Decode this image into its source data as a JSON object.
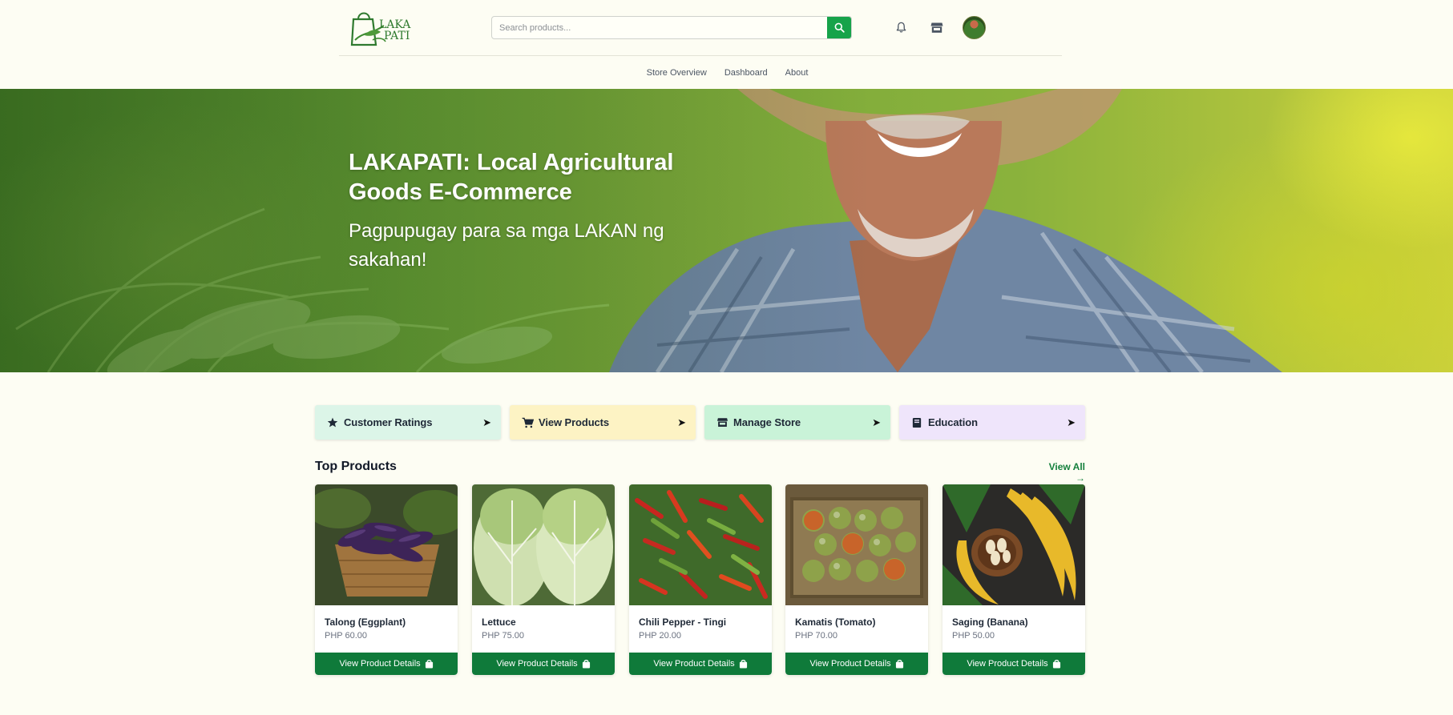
{
  "header": {
    "logo_text": "LAKAPATI",
    "search": {
      "placeholder": "Search products..."
    },
    "icons": [
      "search-icon",
      "bell-icon",
      "store-icon",
      "avatar"
    ]
  },
  "nav": {
    "items": [
      {
        "label": "Store Overview"
      },
      {
        "label": "Dashboard"
      },
      {
        "label": "About"
      }
    ]
  },
  "hero": {
    "title": "LAKAPATI: Local Agricultural Goods E-Commerce",
    "subtitle": "Pagpupugay para sa mga LAKAN ng sakahan!"
  },
  "quick_links": [
    {
      "label": "Customer Ratings",
      "icon": "star-icon",
      "bg": "#dcf5e8"
    },
    {
      "label": "View Products",
      "icon": "cart-icon",
      "bg": "#fdf3c4"
    },
    {
      "label": "Manage Store",
      "icon": "store-icon",
      "bg": "#c9f3d8"
    },
    {
      "label": "Education",
      "icon": "book-icon",
      "bg": "#efe5fb"
    }
  ],
  "top_products": {
    "title": "Top Products",
    "view_all": "View All →",
    "button_label": "View Product Details",
    "items": [
      {
        "name": "Talong (Eggplant)",
        "price": "PHP 60.00"
      },
      {
        "name": "Lettuce",
        "price": "PHP 75.00"
      },
      {
        "name": "Chili Pepper - Tingi",
        "price": "PHP 20.00"
      },
      {
        "name": "Kamatis (Tomato)",
        "price": "PHP 70.00"
      },
      {
        "name": "Saging (Banana)",
        "price": "PHP 50.00"
      }
    ]
  },
  "colors": {
    "accent": "#16a34a",
    "button": "#0f7a3a",
    "background": "#fdfdf3"
  }
}
